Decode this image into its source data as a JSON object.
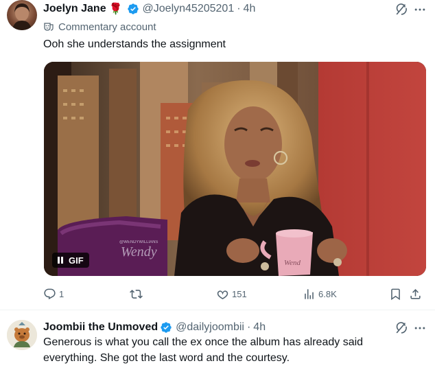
{
  "tweet1": {
    "name": "Joelyn Jane",
    "name_emoji": "🌹",
    "handle": "@Joelyn45205201",
    "separator": "·",
    "time": "4h",
    "account_label": "Commentary account",
    "text": "Ooh she understands the assignment",
    "media": {
      "type": "GIF",
      "badge_label": "GIF",
      "watermark_small": "@WENDYWILLIANS",
      "watermark_large": "Wendy",
      "mug_text": "Wend"
    },
    "actions": {
      "replies": "1",
      "reposts": "",
      "likes": "151",
      "views": "6.8K"
    }
  },
  "tweet2": {
    "name": "Joombii the Unmoved",
    "handle": "@dailyjoombii",
    "separator": "·",
    "time": "4h",
    "text_line1": "Generous is what you call the ex once the album has already said",
    "text_line2": "everything. She got the last word and the courtesy."
  },
  "colors": {
    "verified_blue": "#1d9bf0",
    "secondary_text": "#536471",
    "primary_text": "#0f1419",
    "divider": "#eff3f4"
  },
  "icons": [
    "verified-badge-icon",
    "theater-masks-icon",
    "grok-icon",
    "more-icon",
    "reply-icon",
    "repost-icon",
    "like-icon",
    "views-icon",
    "bookmark-icon",
    "share-icon",
    "pause-icon"
  ]
}
